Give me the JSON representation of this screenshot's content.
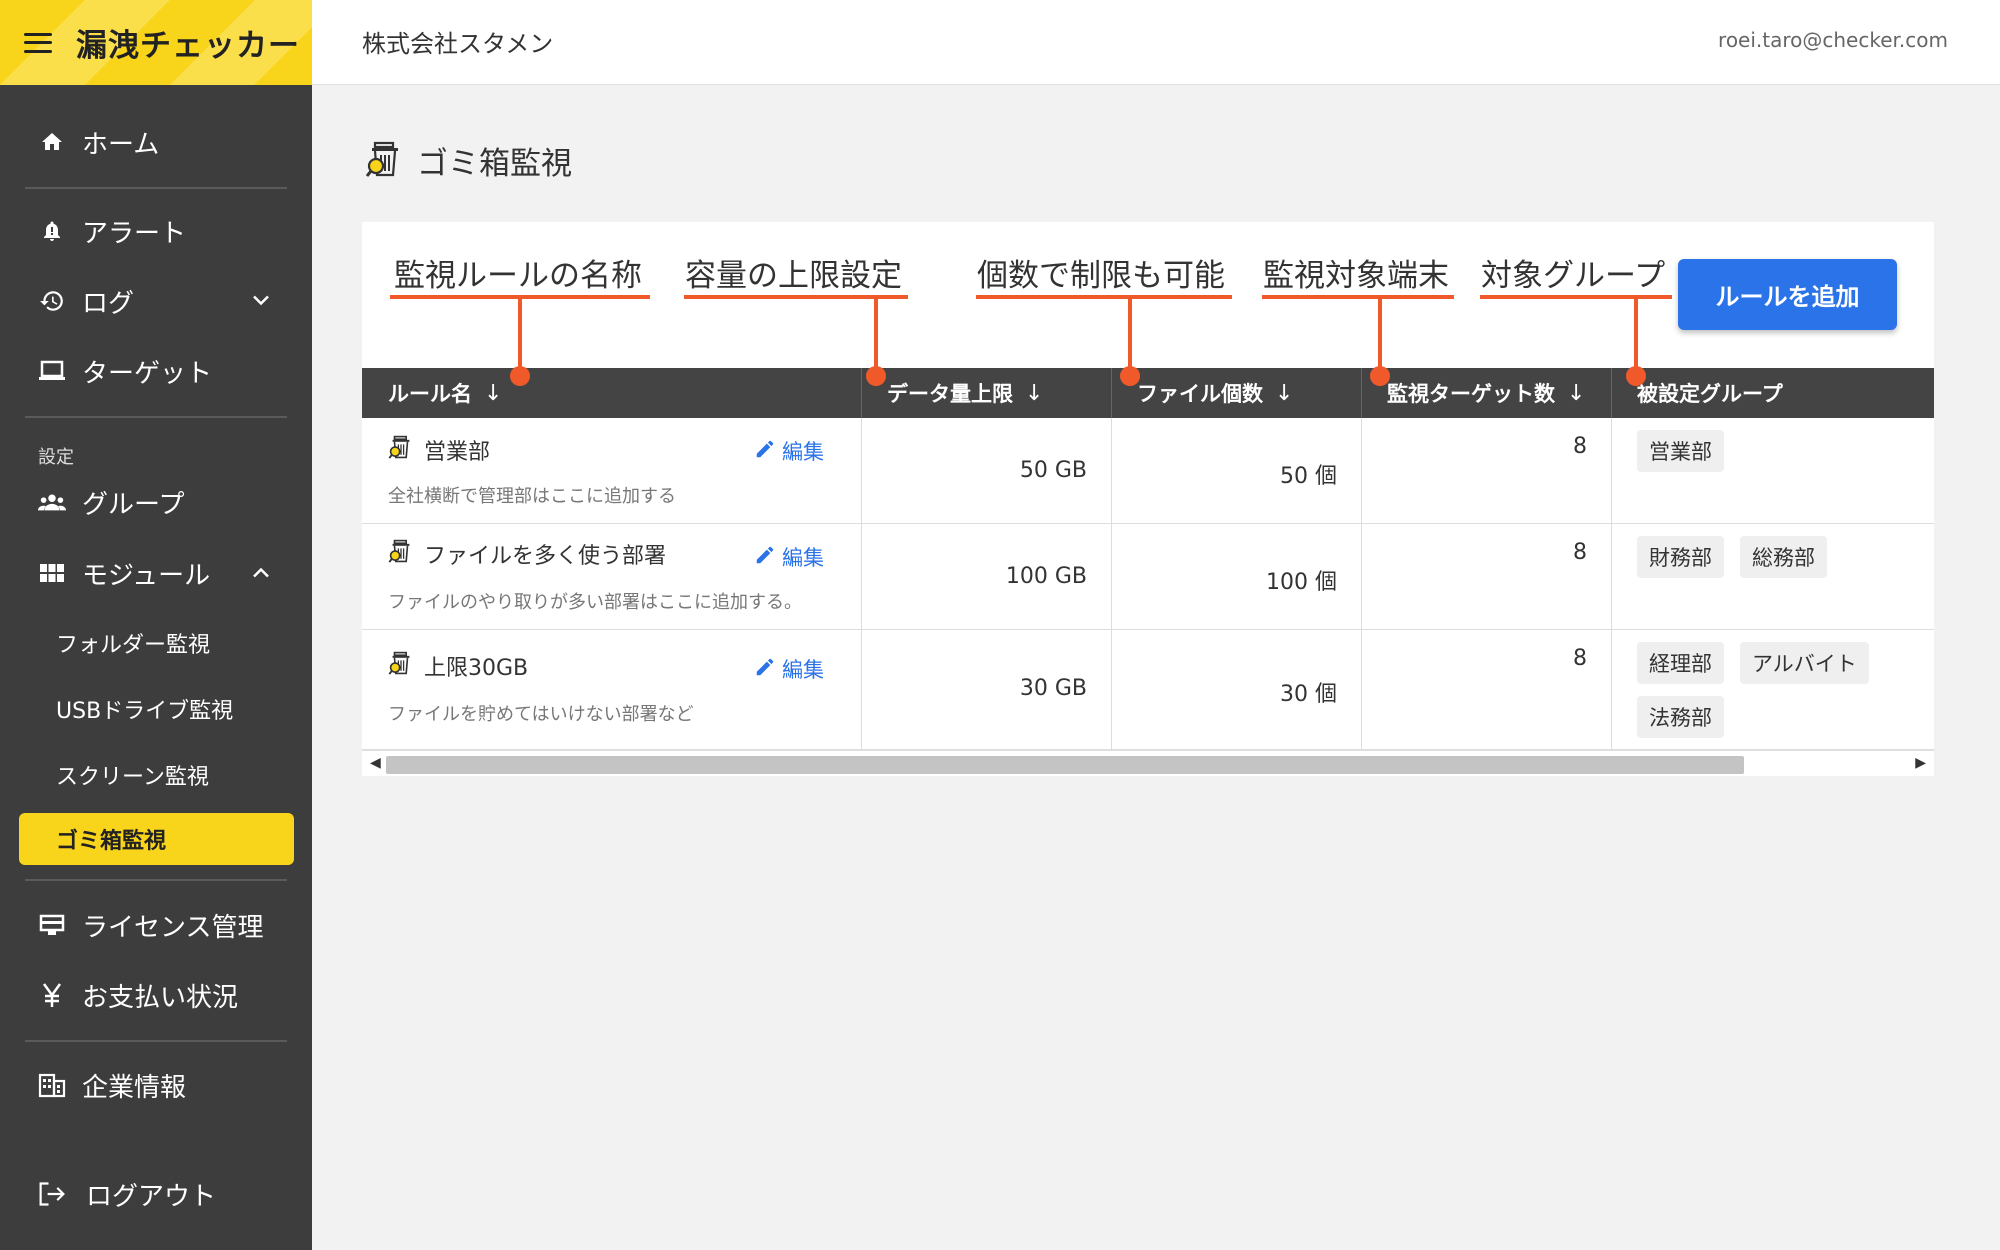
{
  "brand": {
    "title": "漏洩チェッカー"
  },
  "header": {
    "company": "株式会社スタメン",
    "email": "roei.taro@checker.com"
  },
  "sidebar": {
    "home": "ホーム",
    "alert": "アラート",
    "log": "ログ",
    "target": "ターゲット",
    "settings_label": "設定",
    "group": "グループ",
    "module": "モジュール",
    "module_items": [
      "フォルダー監視",
      "USBドライブ監視",
      "スクリーン監視",
      "ゴミ箱監視"
    ],
    "license": "ライセンス管理",
    "payment": "お支払い状況",
    "company_info": "企業情報",
    "logout": "ログアウト"
  },
  "page": {
    "title": "ゴミ箱監視",
    "add_button": "ルールを追加"
  },
  "annotations": [
    "監視ルールの名称",
    "容量の上限設定",
    "個数で制限も可能",
    "監視対象端末",
    "対象グループ"
  ],
  "annotation_color": "#f05a2a",
  "accent_color": "#f8d51a",
  "button_color": "#2b73e8",
  "table": {
    "headers": [
      "ルール名",
      "データ量上限",
      "ファイル個数",
      "監視ターゲット数",
      "被設定グループ"
    ],
    "sort_arrow": "↓",
    "edit_label": "編集",
    "rows": [
      {
        "name": "営業部",
        "desc": "全社横断で管理部はここに追加する",
        "data_limit": "50 GB",
        "file_count": "50 個",
        "targets": "8",
        "groups": [
          "営業部"
        ]
      },
      {
        "name": "ファイルを多く使う部署",
        "desc": "ファイルのやり取りが多い部署はここに追加する。",
        "data_limit": "100 GB",
        "file_count": "100 個",
        "targets": "8",
        "groups": [
          "財務部",
          "総務部"
        ]
      },
      {
        "name": "上限30GB",
        "desc": "ファイルを貯めてはいけない部署など",
        "data_limit": "30 GB",
        "file_count": "30 個",
        "targets": "8",
        "groups": [
          "経理部",
          "アルバイト",
          "法務部"
        ]
      }
    ]
  }
}
